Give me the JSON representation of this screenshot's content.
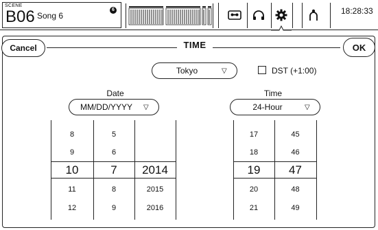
{
  "topbar": {
    "scene_label": "SCENE",
    "scene_number": "B06",
    "scene_name": "Song 6",
    "scene_badge": "6",
    "clock": "18:28:33"
  },
  "dialog": {
    "title": "TIME",
    "cancel_label": "Cancel",
    "ok_label": "OK",
    "timezone": "Tokyo",
    "dst_label": "DST (+1:00)",
    "dst_checked": false,
    "date_label": "Date",
    "date_format": "MM/DD/YYYY",
    "time_label": "Time",
    "time_format": "24-Hour"
  },
  "date_picker": {
    "month": [
      "8",
      "9",
      "10",
      "11",
      "12"
    ],
    "day": [
      "5",
      "6",
      "7",
      "8",
      "9"
    ],
    "year": [
      "",
      "",
      "2014",
      "2015",
      "2016"
    ]
  },
  "time_picker": {
    "hour": [
      "17",
      "18",
      "19",
      "20",
      "21"
    ],
    "minute": [
      "45",
      "46",
      "47",
      "48",
      "49"
    ]
  },
  "icons": [
    "tape-icon",
    "headphones-icon",
    "gear-icon",
    "user-icon",
    "select-arrow-icon"
  ]
}
